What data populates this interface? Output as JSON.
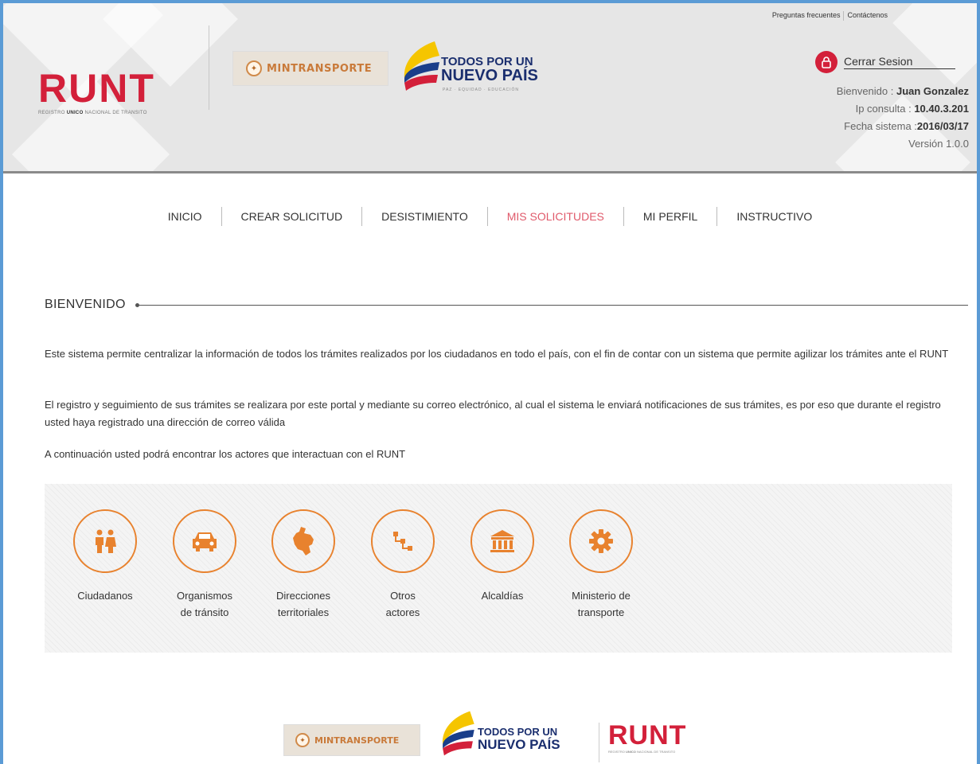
{
  "header": {
    "logo_text": "RUNT",
    "logo_subtitle_pre": "REGISTRO ",
    "logo_subtitle_bold": "UNICO",
    "logo_subtitle_post": " NACIONAL DE TRANSITO",
    "mintransporte": "MINTRANSPORTE",
    "slogan_line1": "TODOS POR UN",
    "slogan_line2": "NUEVO PAÍS",
    "slogan_line3": "PAZ · EQUIDAD · EDUCACIÓN",
    "top_links": [
      "Preguntas frecuentes",
      "Contáctenos"
    ],
    "logout_label": "Cerrar Sesion",
    "welcome_label": "Bienvenido : ",
    "user_name": "Juan Gonzalez",
    "ip_label": "Ip consulta : ",
    "ip_value": "10.40.3.201",
    "date_label": "Fecha sistema :",
    "date_value": "2016/03/17",
    "version": "Versión 1.0.0"
  },
  "nav": {
    "items": [
      "INICIO",
      "CREAR SOLICITUD",
      "DESISTIMIENTO",
      "MIS SOLICITUDES",
      "MI PERFIL",
      "INSTRUCTIVO"
    ],
    "active": "MIS SOLICITUDES"
  },
  "welcome": {
    "title": "BIENVENIDO",
    "paragraphs": [
      "Este sistema permite centralizar la información de todos los trámites realizados por los ciudadanos en todo el país, con el fin de contar con un sistema que permite agilizar los trámites ante el RUNT",
      "El registro y seguimiento de sus trámites se realizara por este portal y mediante su correo electrónico, al cual el sistema le enviará notificaciones de sus trámites, es por eso que durante el registro usted haya registrado una dirección de correo válida",
      "A continuación usted podrá encontrar los actores que interactuan con el RUNT"
    ]
  },
  "actors": [
    {
      "icon": "people-icon",
      "line1": "Ciudadanos",
      "line2": ""
    },
    {
      "icon": "car-icon",
      "line1": "Organismos",
      "line2": "de tránsito"
    },
    {
      "icon": "colombia-map-icon",
      "line1": "Direcciones",
      "line2": "territoriales"
    },
    {
      "icon": "network-icon",
      "line1": "Otros",
      "line2": "actores"
    },
    {
      "icon": "building-icon",
      "line1": "Alcaldías",
      "line2": ""
    },
    {
      "icon": "gear-icon",
      "line1": "Ministerio de",
      "line2": "transporte"
    }
  ],
  "colors": {
    "brand_red": "#d3203a",
    "accent_orange": "#e8822e",
    "nav_active": "#e05a6b",
    "frame_blue": "#5b9bd5"
  }
}
